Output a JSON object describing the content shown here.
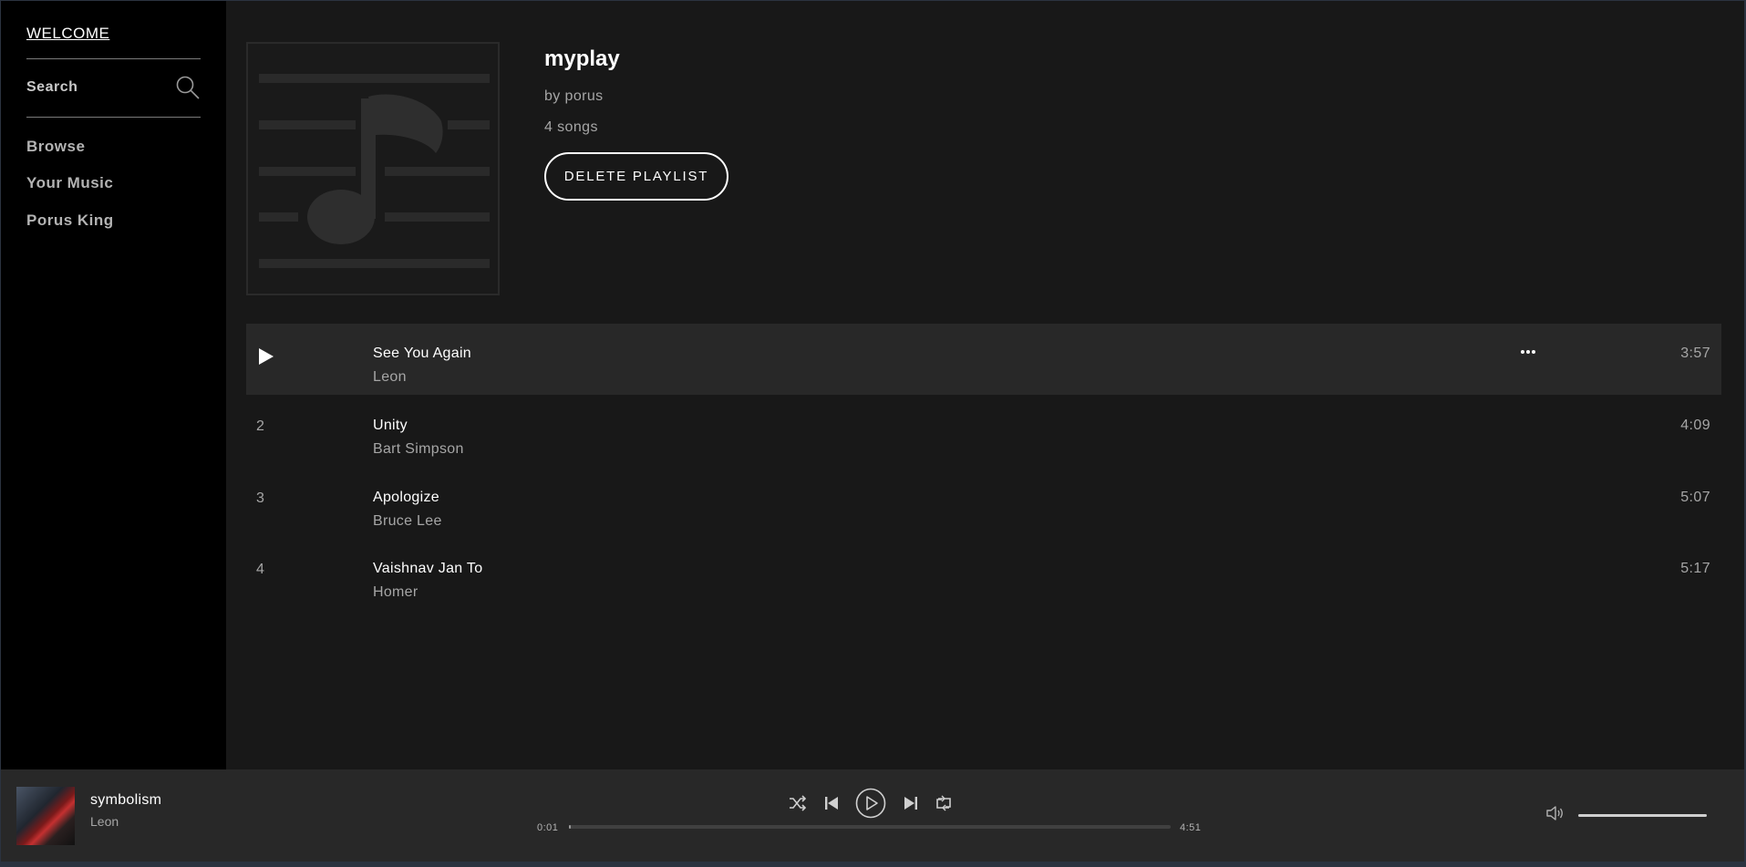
{
  "sidebar": {
    "logo": "WELCOME",
    "search_label": "Search",
    "nav": [
      "Browse",
      "Your Music",
      "Porus King"
    ]
  },
  "playlist": {
    "title": "myplay",
    "owner": "by porus",
    "count": "4 songs",
    "delete_label": "DELETE PLAYLIST"
  },
  "tracks": [
    {
      "num": "1",
      "name": "See You Again",
      "artist": "Leon",
      "duration": "3:57",
      "playing": true
    },
    {
      "num": "2",
      "name": "Unity",
      "artist": "Bart Simpson",
      "duration": "4:09"
    },
    {
      "num": "3",
      "name": "Apologize",
      "artist": "Bruce Lee",
      "duration": "5:07"
    },
    {
      "num": "4",
      "name": "Vaishnav Jan To",
      "artist": "Homer",
      "duration": "5:17"
    }
  ],
  "player": {
    "title": "symbolism",
    "artist": "Leon",
    "elapsed": "0:01",
    "total": "4:51",
    "progress_fraction": 0.003,
    "volume_fraction": 1.0
  },
  "icons": {
    "search": "search-icon",
    "play": "play-icon",
    "more": "more-options-icon",
    "shuffle": "shuffle-icon",
    "previous": "skip-previous-icon",
    "play_pause": "play-circle-icon",
    "next": "skip-next-icon",
    "repeat": "repeat-icon",
    "volume": "volume-icon"
  }
}
